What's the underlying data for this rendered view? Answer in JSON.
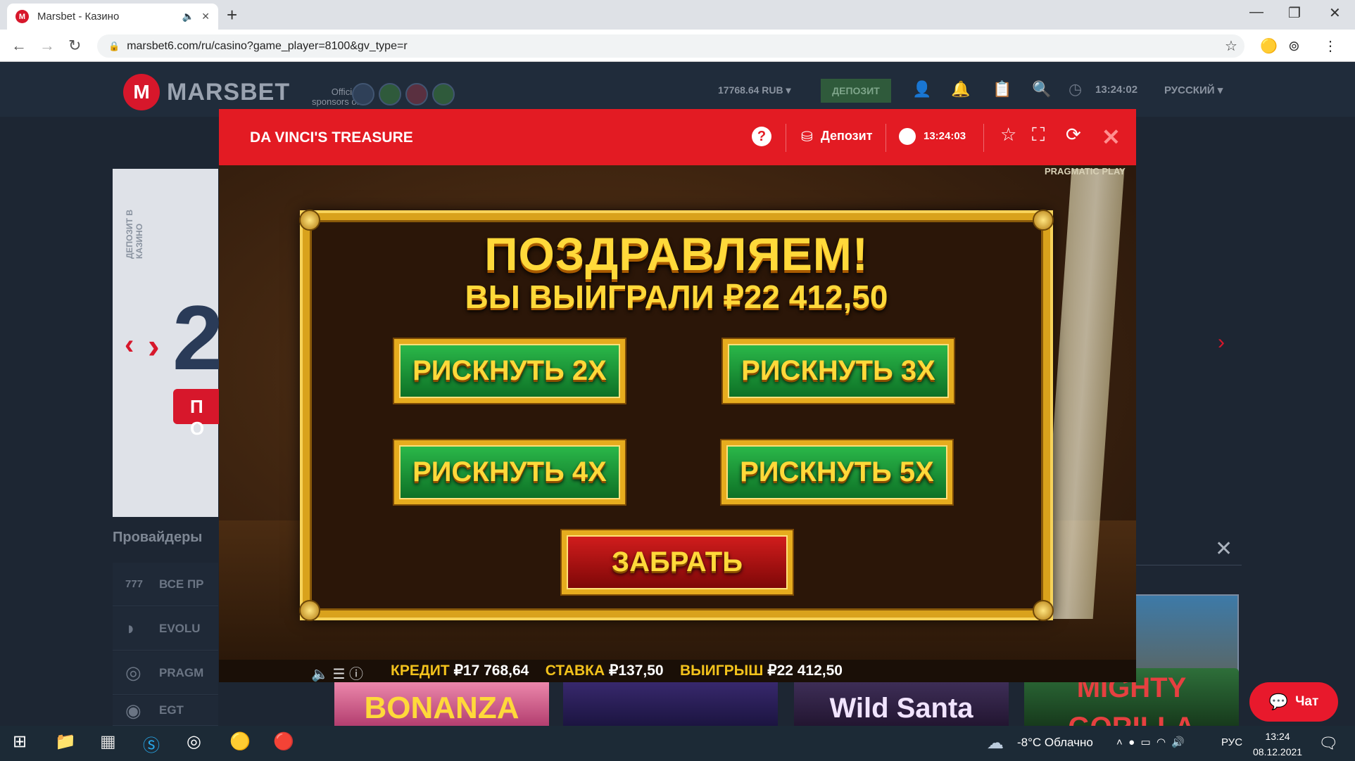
{
  "browser": {
    "tab_title": "Marsbet - Казино",
    "favicon_letter": "M",
    "new_tab": "+",
    "url": "marsbet6.com/ru/casino?game_player=8100&gv_type=r",
    "minimize": "—",
    "maximize": "❐",
    "close": "✕"
  },
  "site": {
    "logo_letter": "M",
    "logo_text": "MARSBET",
    "sponsor_line1": "Official",
    "sponsor_line2": "sponsors of",
    "balance": "17768.64 RUB",
    "deposit_button": "ДЕПОЗИТ",
    "time": "13:24:02",
    "language": "РУССКИЙ",
    "banner_vertical_text": "ДЕПОЗИТ В КАЗИНО",
    "banner_big": "2",
    "banner_button": "П О",
    "providers_title": "Провайдеры",
    "providers": [
      {
        "icon": "777",
        "name": "ВСЕ ПР"
      },
      {
        "icon": "◗",
        "name": "EVOLU"
      },
      {
        "icon": "◎",
        "name": "PRAGM"
      },
      {
        "icon": "◉",
        "name": "EGT"
      }
    ],
    "game_tiles": [
      "BONANZA",
      "",
      "Wild Santa",
      "MIGHTY GORILLA"
    ],
    "chat_button": "Чат"
  },
  "game": {
    "title": "DA VINCI'S TREASURE",
    "help": "?",
    "deposit_label": "Депозит",
    "time": "13:24:03",
    "provider": "PRAGMATIC PLAY",
    "congrats": "ПОЗДРАВЛЯЕМ!",
    "won_text": "ВЫ ВЫИГРАЛИ ₽22 412,50",
    "risk_buttons": [
      "РИСКНУТЬ 2X",
      "РИСКНУТЬ 3X",
      "РИСКНУТЬ 4X",
      "РИСКНУТЬ 5X"
    ],
    "collect_button": "ЗАБРАТЬ",
    "credit_label": "КРЕДИТ",
    "credit_value": "₽17 768,64",
    "bet_label": "СТАВКА",
    "bet_value": "₽137,50",
    "win_label": "ВЫИГРЫШ",
    "win_value": "₽22 412,50"
  },
  "taskbar": {
    "weather": "-8°C  Облачно",
    "lang": "РУС",
    "time": "13:24",
    "date": "08.12.2021"
  },
  "colors": {
    "brand_red": "#e31b23",
    "gold": "#ffd93a",
    "green_button": "#1f9a3a"
  }
}
